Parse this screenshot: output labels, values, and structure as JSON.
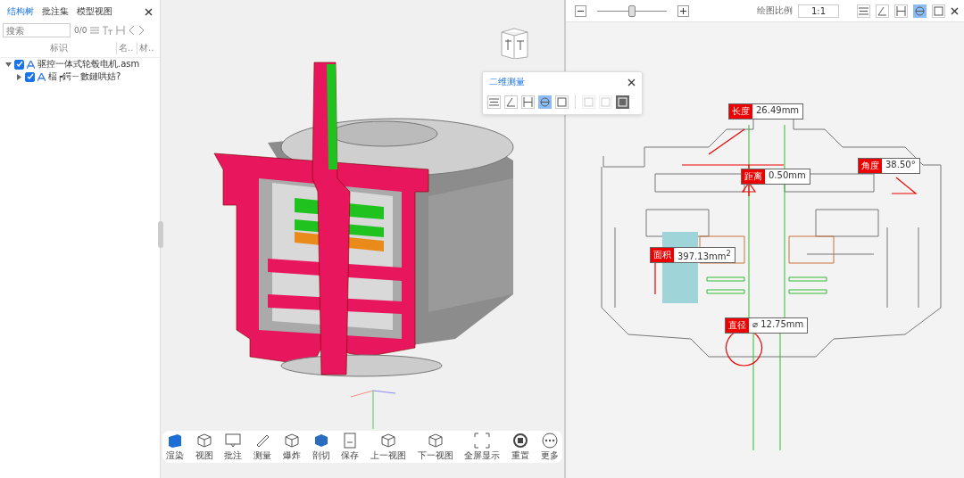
{
  "sidebar": {
    "tabs": [
      {
        "label": "结构树",
        "selected": true
      },
      {
        "label": "批注集",
        "selected": false
      },
      {
        "label": "模型视图",
        "selected": false
      }
    ],
    "search": {
      "placeholder": "搜索",
      "count": "0/0"
    },
    "columns": [
      "标识",
      "名..",
      "材.."
    ],
    "tree": [
      {
        "label": "驱控一体式轮毂电机.asm",
        "checked": true,
        "expanded": true,
        "children": [
          {
            "label": "楅┍鍔ㄧ數鏈哄姞?",
            "checked": true,
            "expanded": false
          }
        ]
      }
    ]
  },
  "measure_panel": {
    "title": "二维测量",
    "tools": [
      {
        "selected": false
      },
      {
        "selected": false
      },
      {
        "selected": false
      },
      {
        "selected": true
      },
      {
        "selected": false
      }
    ],
    "extra_tools": [
      {
        "disabled": true
      },
      {
        "disabled": true
      },
      {
        "disabled": false
      }
    ]
  },
  "toolbar": [
    {
      "label": "渲染"
    },
    {
      "label": "视图"
    },
    {
      "label": "批注"
    },
    {
      "label": "测量"
    },
    {
      "label": "爆炸"
    },
    {
      "label": "剖切"
    },
    {
      "label": "保存"
    },
    {
      "label": "上一视图"
    },
    {
      "label": "下一视图"
    },
    {
      "label": "全屏显示"
    },
    {
      "label": "重置"
    },
    {
      "label": "更多"
    }
  ],
  "drawing_view": {
    "zoom": {
      "level": 0.5
    },
    "scale_label": "绘图比例",
    "scale": "1:1",
    "tools": [
      {
        "selected": false
      },
      {
        "selected": false
      },
      {
        "selected": false
      },
      {
        "selected": true
      },
      {
        "selected": false
      }
    ],
    "annotations": [
      {
        "kind": "length",
        "label": "长度",
        "value": "26.49mm"
      },
      {
        "kind": "distance",
        "label": "距离",
        "value": "0.50mm"
      },
      {
        "kind": "angle",
        "label": "角度",
        "value": "38.50°"
      },
      {
        "kind": "area",
        "label": "面积",
        "value": "397.13mm$^{2}$"
      },
      {
        "kind": "diameter",
        "label": "直径",
        "value": "⌀ 12.75mm"
      }
    ]
  }
}
